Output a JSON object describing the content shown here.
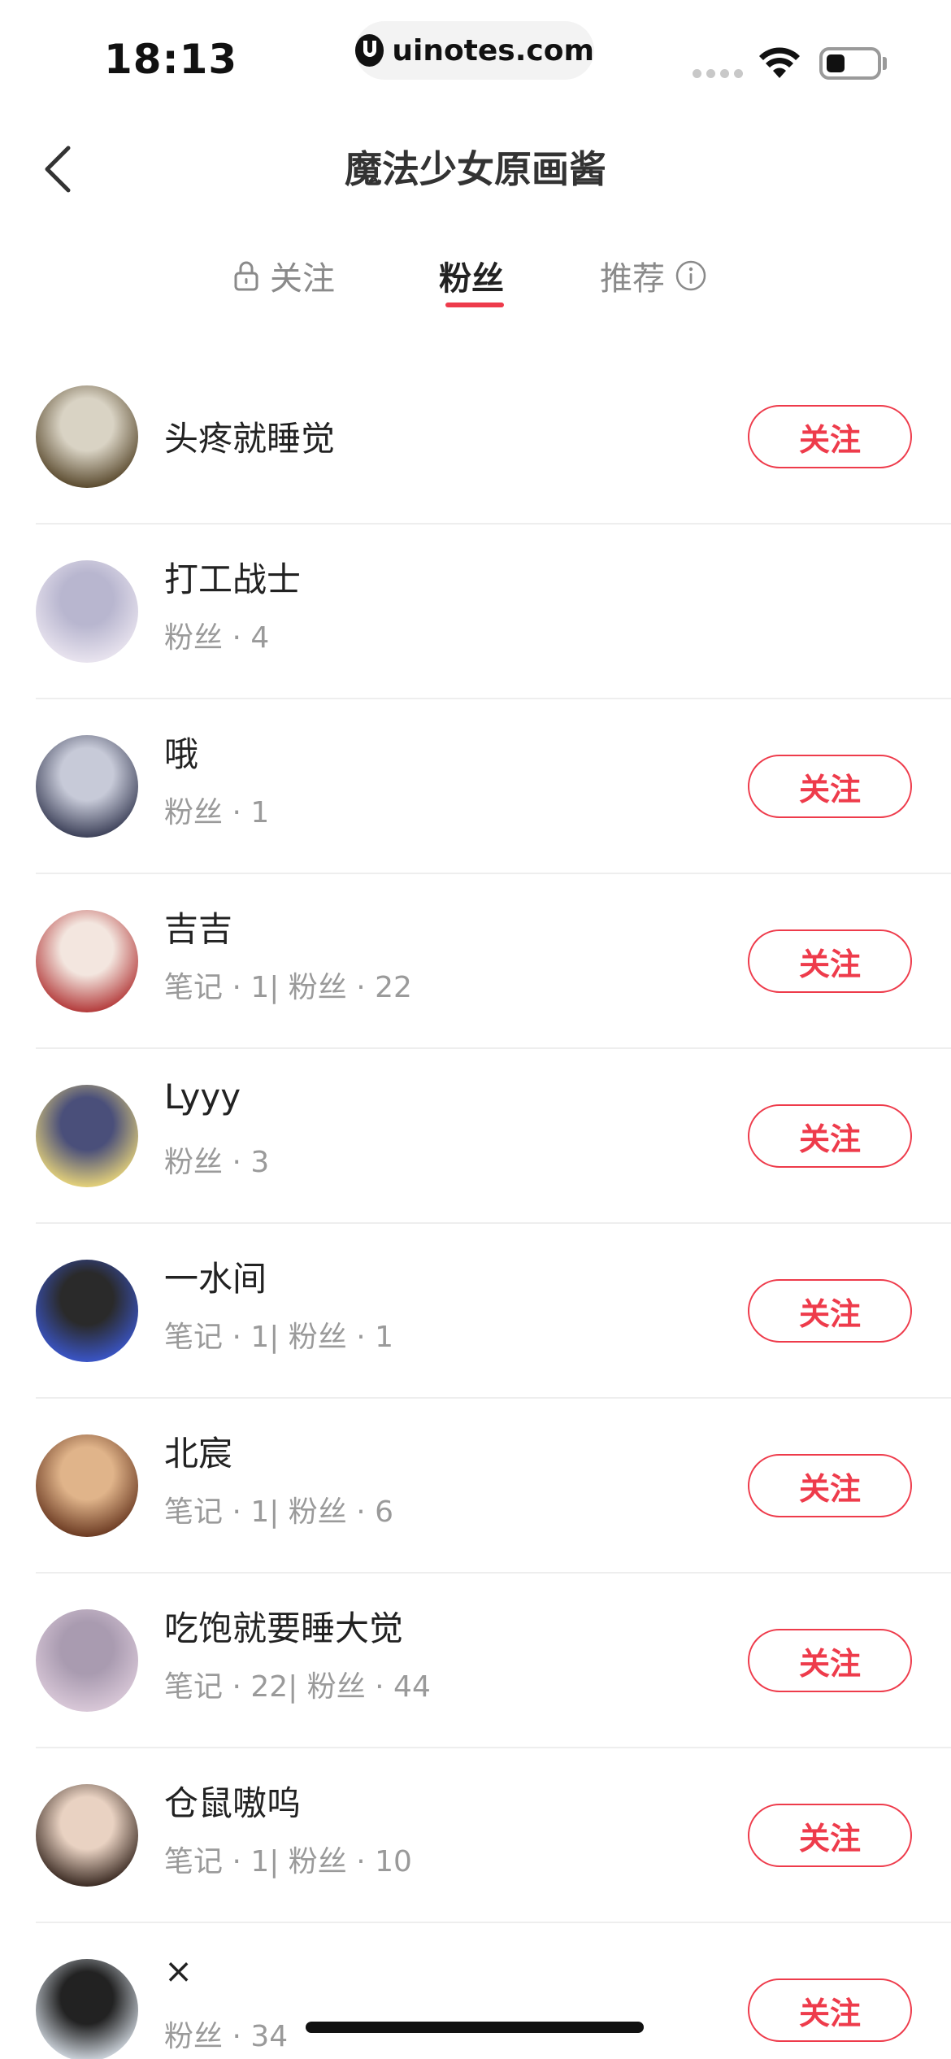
{
  "status_bar": {
    "time": "18:13",
    "url": "uinotes.com"
  },
  "nav": {
    "title": "魔法少女原画酱"
  },
  "tabs": [
    {
      "label": "关注",
      "icon": "lock-icon",
      "active": false
    },
    {
      "label": "粉丝",
      "active": true
    },
    {
      "label": "推荐",
      "icon": "info-icon",
      "active": false
    }
  ],
  "accent_color": "#ee3b4b",
  "users": [
    {
      "name": "头疼就睡觉",
      "meta": "",
      "button": "关注",
      "avatar_colors": [
        "#5a4a2e",
        "#d9d3c4"
      ]
    },
    {
      "name": "打工战士",
      "meta": "粉丝 · 4",
      "button": "",
      "avatar_colors": [
        "#e9e4ef",
        "#b8b6cf"
      ]
    },
    {
      "name": "哦",
      "meta": "粉丝 · 1",
      "button": "关注",
      "avatar_colors": [
        "#3c4058",
        "#c7cad8"
      ]
    },
    {
      "name": "吉吉",
      "meta": "笔记 · 1| 粉丝 · 22",
      "button": "关注",
      "avatar_colors": [
        "#b33a3a",
        "#f3e6df"
      ]
    },
    {
      "name": "Lyyy",
      "meta": "粉丝 · 3",
      "button": "关注",
      "avatar_colors": [
        "#e5d27a",
        "#4a4f7a"
      ]
    },
    {
      "name": "一水间",
      "meta": "笔记 · 1| 粉丝 · 1",
      "button": "关注",
      "avatar_colors": [
        "#3a55c8",
        "#2a2a2a"
      ]
    },
    {
      "name": "北宸",
      "meta": "笔记 · 1| 粉丝 · 6",
      "button": "关注",
      "avatar_colors": [
        "#6b3a22",
        "#e0b48a"
      ]
    },
    {
      "name": "吃饱就要睡大觉",
      "meta": "笔记 · 22| 粉丝 · 44",
      "button": "关注",
      "avatar_colors": [
        "#d9c8d8",
        "#a99bb0"
      ]
    },
    {
      "name": "仓鼠嗷呜",
      "meta": "笔记 · 1| 粉丝 · 10",
      "button": "关注",
      "avatar_colors": [
        "#3a2a22",
        "#e9d2c2"
      ]
    },
    {
      "name": "×",
      "meta": "粉丝 · 34",
      "button": "关注",
      "avatar_colors": [
        "#cfd6de",
        "#222222"
      ]
    }
  ]
}
